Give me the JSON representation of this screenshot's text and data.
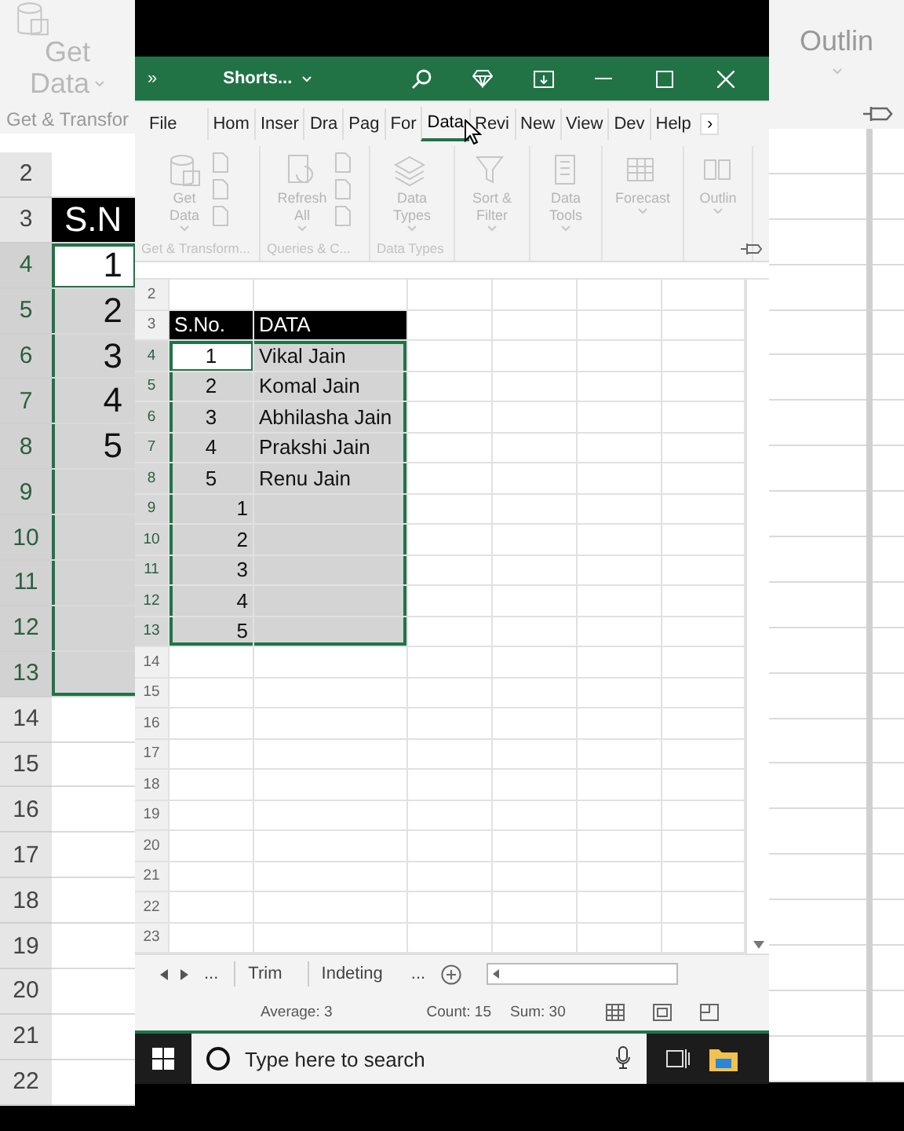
{
  "background_left": {
    "ribbon": {
      "command_lines": [
        "Get",
        "Data"
      ],
      "group_label": "Get & Transfor"
    },
    "rows": [
      {
        "number": "2",
        "kind": "blank",
        "selected": false,
        "active": false
      },
      {
        "number": "3",
        "kind": "header",
        "value": "S.N",
        "selected": false,
        "active": false
      },
      {
        "number": "4",
        "kind": "data",
        "value": "1",
        "selected": true,
        "active": true
      },
      {
        "number": "5",
        "kind": "data",
        "value": "2",
        "selected": true,
        "active": false
      },
      {
        "number": "6",
        "kind": "data",
        "value": "3",
        "selected": true,
        "active": false
      },
      {
        "number": "7",
        "kind": "data",
        "value": "4",
        "selected": true,
        "active": false
      },
      {
        "number": "8",
        "kind": "data",
        "value": "5",
        "selected": true,
        "active": false
      },
      {
        "number": "9",
        "kind": "data",
        "selected": true,
        "active": false
      },
      {
        "number": "10",
        "kind": "data",
        "selected": true,
        "active": false
      },
      {
        "number": "11",
        "kind": "data",
        "selected": true,
        "active": false
      },
      {
        "number": "12",
        "kind": "data",
        "selected": true,
        "active": false
      },
      {
        "number": "13",
        "kind": "data",
        "selected": true,
        "active": false
      },
      {
        "number": "14",
        "kind": "blank",
        "selected": false,
        "active": false
      },
      {
        "number": "15",
        "kind": "blank",
        "selected": false,
        "active": false
      },
      {
        "number": "16",
        "kind": "blank",
        "selected": false,
        "active": false
      },
      {
        "number": "17",
        "kind": "blank",
        "selected": false,
        "active": false
      },
      {
        "number": "18",
        "kind": "blank",
        "selected": false,
        "active": false
      },
      {
        "number": "19",
        "kind": "blank",
        "selected": false,
        "active": false
      },
      {
        "number": "20",
        "kind": "blank",
        "selected": false,
        "active": false
      },
      {
        "number": "21",
        "kind": "blank",
        "selected": false,
        "active": false
      },
      {
        "number": "22",
        "kind": "blank",
        "selected": false,
        "active": false
      }
    ]
  },
  "background_right": {
    "ribbon": {
      "command_label": "Outlin"
    }
  },
  "title_bar": {
    "overflow": "»",
    "title": "Shorts..."
  },
  "ribbon": {
    "disabled": true,
    "more": "›",
    "tabs": [
      {
        "label": "File",
        "selected": false
      },
      {
        "label": "Hom",
        "selected": false
      },
      {
        "label": "Inser",
        "selected": false
      },
      {
        "label": "Dra",
        "selected": false
      },
      {
        "label": "Pag",
        "selected": false
      },
      {
        "label": "For",
        "selected": false
      },
      {
        "label": "Data",
        "selected": true
      },
      {
        "label": "Revi",
        "selected": false
      },
      {
        "label": "New",
        "selected": false
      },
      {
        "label": "View",
        "selected": false
      },
      {
        "label": "Dev",
        "selected": false
      },
      {
        "label": "Help",
        "selected": false
      }
    ],
    "groups": [
      {
        "label": "Get & Transform...",
        "kind": "wide",
        "command": [
          "Get",
          "Data"
        ]
      },
      {
        "label": "Queries & C...",
        "kind": "wide",
        "command": [
          "Refresh",
          "All"
        ]
      },
      {
        "label": "Data Types",
        "kind": "single",
        "command": [
          "Data",
          "Types"
        ]
      },
      {
        "kind": "single",
        "command": [
          "Sort &",
          "Filter"
        ]
      },
      {
        "kind": "single",
        "command": [
          "Data",
          "Tools"
        ]
      },
      {
        "kind": "single",
        "command": [
          "Forecast"
        ]
      },
      {
        "kind": "single",
        "command": [
          "Outlin"
        ]
      }
    ]
  },
  "sheet": {
    "rows": [
      {
        "number": "2",
        "kind": "blank",
        "selected": false,
        "active": false
      },
      {
        "number": "3",
        "kind": "header",
        "a": "S.No.",
        "b": "DATA",
        "selected": false,
        "active": false
      },
      {
        "number": "4",
        "kind": "entry",
        "a": "1",
        "b": "Vikal Jain",
        "selected": true,
        "active": true
      },
      {
        "number": "5",
        "kind": "entry",
        "a": "2",
        "b": "Komal Jain",
        "selected": true,
        "active": false
      },
      {
        "number": "6",
        "kind": "entry",
        "a": "3",
        "b": "Abhilasha Jain",
        "selected": true,
        "active": false
      },
      {
        "number": "7",
        "kind": "entry",
        "a": "4",
        "b": "Prakshi Jain",
        "selected": true,
        "active": false
      },
      {
        "number": "8",
        "kind": "entry",
        "a": "5",
        "b": "Renu Jain",
        "selected": true,
        "active": false
      },
      {
        "number": "9",
        "kind": "series",
        "a": "1",
        "selected": true,
        "active": false
      },
      {
        "number": "10",
        "kind": "series",
        "a": "2",
        "selected": true,
        "active": false
      },
      {
        "number": "11",
        "kind": "series",
        "a": "3",
        "selected": true,
        "active": false
      },
      {
        "number": "12",
        "kind": "series",
        "a": "4",
        "selected": true,
        "active": false
      },
      {
        "number": "13",
        "kind": "series",
        "a": "5",
        "selected": true,
        "active": false
      },
      {
        "number": "14",
        "kind": "blank",
        "selected": false,
        "active": false
      },
      {
        "number": "15",
        "kind": "blank",
        "selected": false,
        "active": false
      },
      {
        "number": "16",
        "kind": "blank",
        "selected": false,
        "active": false
      },
      {
        "number": "17",
        "kind": "blank",
        "selected": false,
        "active": false
      },
      {
        "number": "18",
        "kind": "blank",
        "selected": false,
        "active": false
      },
      {
        "number": "19",
        "kind": "blank",
        "selected": false,
        "active": false
      },
      {
        "number": "20",
        "kind": "blank",
        "selected": false,
        "active": false
      },
      {
        "number": "21",
        "kind": "blank",
        "selected": false,
        "active": false
      },
      {
        "number": "22",
        "kind": "blank",
        "selected": false,
        "active": false
      },
      {
        "number": "23",
        "kind": "blank",
        "selected": false,
        "active": false
      }
    ]
  },
  "sheet_tabs": [
    {
      "label": "...",
      "kind": "more"
    },
    {
      "label": "Trim",
      "kind": "sheet",
      "selected": false
    },
    {
      "label": "Indeting",
      "kind": "sheet",
      "selected": false
    },
    {
      "label": "...",
      "kind": "more"
    }
  ],
  "status_bar": {
    "items": [
      "Average: 3",
      "Count: 15",
      "Sum: 30"
    ]
  },
  "taskbar": {
    "search": {
      "placeholder": "Type here to search"
    }
  }
}
